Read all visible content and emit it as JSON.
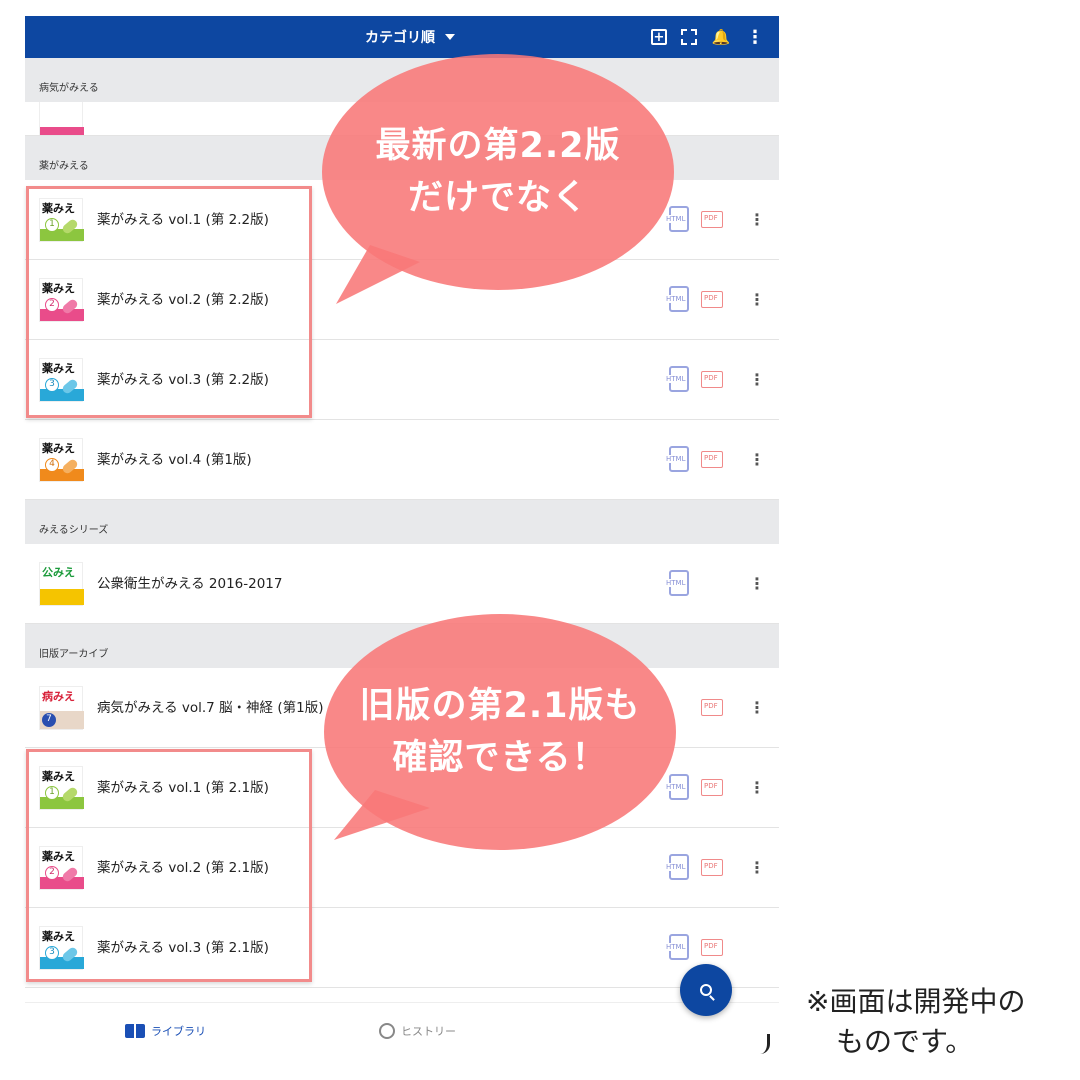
{
  "header": {
    "sort_label": "カテゴリ順"
  },
  "sections": [
    {
      "label": "病気がみえる"
    },
    {
      "label": "薬がみえる"
    },
    {
      "label": "みえるシリーズ"
    },
    {
      "label": "旧版アーカイブ"
    }
  ],
  "rows": [
    {
      "title": "薬がみえる vol.1 (第 2.2版)",
      "thumb_text": "薬みえ",
      "num": "1"
    },
    {
      "title": "薬がみえる vol.2 (第 2.2版)",
      "thumb_text": "薬みえ",
      "num": "2"
    },
    {
      "title": "薬がみえる vol.3 (第 2.2版)",
      "thumb_text": "薬みえ",
      "num": "3"
    },
    {
      "title": "薬がみえる vol.4 (第1版)",
      "thumb_text": "薬みえ",
      "num": "4"
    },
    {
      "title": "公衆衛生がみえる 2016-2017",
      "thumb_text": "公みえ",
      "num": ""
    },
    {
      "title": "病気がみえる vol.7 脳・神経 (第1版)",
      "thumb_text": "病みえ",
      "num": "7"
    },
    {
      "title": "薬がみえる vol.1 (第 2.1版)",
      "thumb_text": "薬みえ",
      "num": "1"
    },
    {
      "title": "薬がみえる vol.2 (第 2.1版)",
      "thumb_text": "薬みえ",
      "num": "2"
    },
    {
      "title": "薬がみえる vol.3 (第 2.1版)",
      "thumb_text": "薬みえ",
      "num": "3"
    }
  ],
  "format_labels": {
    "html": "HTML",
    "pdf": "PDF"
  },
  "bubbles": {
    "top": [
      "最新の第2.2版",
      "だけでなく"
    ],
    "bottom": [
      "旧版の第2.1版も",
      "確認できる！"
    ]
  },
  "tabs": {
    "library": "ライブラリ",
    "history": "ヒストリー"
  },
  "note": [
    "※画面は開発中の",
    "ものです。"
  ],
  "colors": {
    "header": "#0d47a1",
    "bubble": "#f87878",
    "highlight": "#f28b8b"
  }
}
